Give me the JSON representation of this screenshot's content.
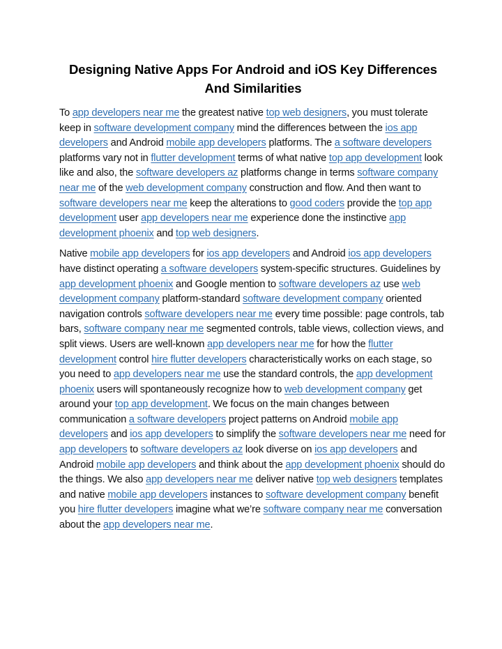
{
  "document": {
    "title": "Designing Native Apps For Android and iOS Key Differences And Similarities",
    "link_color": "#2e6eb1",
    "paragraphs": [
      [
        {
          "t": "To "
        },
        {
          "link": "app developers near me"
        },
        {
          "t": " the greatest native "
        },
        {
          "link": "top web designers"
        },
        {
          "t": ", you must tolerate keep in "
        },
        {
          "link": "software development company"
        },
        {
          "t": " mind the differences between the "
        },
        {
          "link": "ios app developers"
        },
        {
          "t": " and Android "
        },
        {
          "link": "mobile app developers"
        },
        {
          "t": " platforms. The "
        },
        {
          "link": "a software developers"
        },
        {
          "t": " platforms vary not in "
        },
        {
          "link": "flutter development"
        },
        {
          "t": " terms of what native "
        },
        {
          "link": "top app development"
        },
        {
          "t": " look like and also, the "
        },
        {
          "link": "software developers az"
        },
        {
          "t": " platforms change in terms "
        },
        {
          "link": "software company near me"
        },
        {
          "t": " of the "
        },
        {
          "link": "web development company"
        },
        {
          "t": " construction and flow. And then want to "
        },
        {
          "link": "software developers near me"
        },
        {
          "t": " keep the alterations to "
        },
        {
          "link": "good coders"
        },
        {
          "t": " provide the "
        },
        {
          "link": "top app development"
        },
        {
          "t": " user "
        },
        {
          "link": "app developers near me"
        },
        {
          "t": " experience done the instinctive "
        },
        {
          "link": "app development phoenix"
        },
        {
          "t": " and "
        },
        {
          "link": "top web designers"
        },
        {
          "t": "."
        }
      ],
      [
        {
          "t": "Native "
        },
        {
          "link": "mobile app developers"
        },
        {
          "t": " for "
        },
        {
          "link": "ios app developers"
        },
        {
          "t": " and Android "
        },
        {
          "link": "ios app developers"
        },
        {
          "t": " have distinct operating "
        },
        {
          "link": "a software developers"
        },
        {
          "t": " system-specific structures. Guidelines by "
        },
        {
          "link": "app development phoenix"
        },
        {
          "t": " and Google mention to "
        },
        {
          "link": "software developers az"
        },
        {
          "t": " use "
        },
        {
          "link": "web development company"
        },
        {
          "t": " platform-standard "
        },
        {
          "link": "software development company"
        },
        {
          "t": " oriented navigation controls "
        },
        {
          "link": "software developers near me"
        },
        {
          "t": " every time possible: page controls, tab bars, "
        },
        {
          "link": "software company near me"
        },
        {
          "t": " segmented controls, table views, collection views, and split views. Users are well-known "
        },
        {
          "link": "app developers near me"
        },
        {
          "t": " for how the "
        },
        {
          "link": "flutter development"
        },
        {
          "t": " control "
        },
        {
          "link": "hire flutter developers"
        },
        {
          "t": " characteristically works on each stage, so you need to "
        },
        {
          "link": "app developers near me"
        },
        {
          "t": " use the standard controls, the "
        },
        {
          "link": "app development phoenix"
        },
        {
          "t": " users will spontaneously recognize how to "
        },
        {
          "link": "web development company"
        },
        {
          "t": " get around your "
        },
        {
          "link": "top app development"
        },
        {
          "t": ". We focus on the main changes between communication "
        },
        {
          "link": "a software developers"
        },
        {
          "t": " project patterns on Android "
        },
        {
          "link": "mobile app developers"
        },
        {
          "t": " and "
        },
        {
          "link": "ios app developers"
        },
        {
          "t": " to simplify the "
        },
        {
          "link": "software developers near me"
        },
        {
          "t": " need for "
        },
        {
          "link": "app developers"
        },
        {
          "t": " to "
        },
        {
          "link": "software developers az"
        },
        {
          "t": " look diverse on "
        },
        {
          "link": "ios app developers"
        },
        {
          "t": " and Android "
        },
        {
          "link": "mobile app developers"
        },
        {
          "t": " and think about the "
        },
        {
          "link": "app development phoenix"
        },
        {
          "t": " should do the things. We also "
        },
        {
          "link": "app developers near me"
        },
        {
          "t": " deliver native "
        },
        {
          "link": "top web designers"
        },
        {
          "t": " templates and native "
        },
        {
          "link": "mobile app developers"
        },
        {
          "t": " instances to "
        },
        {
          "link": "software development company"
        },
        {
          "t": " benefit you "
        },
        {
          "link": "hire flutter developers"
        },
        {
          "t": " imagine what we’re "
        },
        {
          "link": "software company near me"
        },
        {
          "t": " conversation about the "
        },
        {
          "link": "app developers near me"
        },
        {
          "t": "."
        }
      ]
    ]
  }
}
